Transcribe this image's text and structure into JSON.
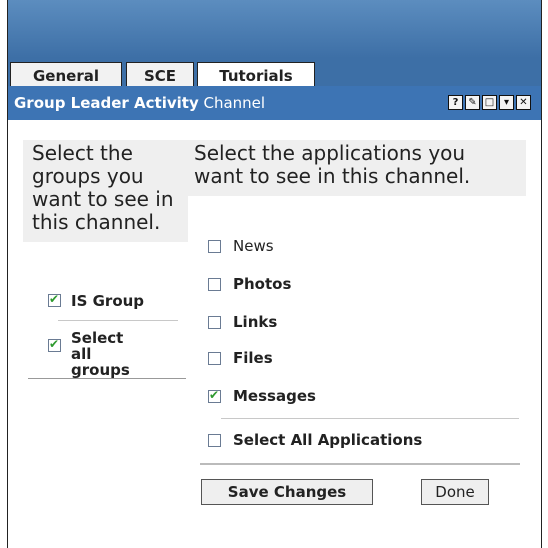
{
  "tabs": [
    "General",
    "SCE",
    "Tutorials"
  ],
  "channel": {
    "title_bold": "Group Leader Activity",
    "title_normal": " Channel"
  },
  "window_buttons": [
    "help-icon",
    "edit-icon",
    "maximize-icon",
    "minimize-icon",
    "close-icon"
  ],
  "groups": {
    "intro": "Select the groups you want to see in this channel.",
    "items": [
      {
        "label": "IS Group",
        "checked": true
      },
      {
        "label": "Select all groups",
        "checked": true
      }
    ]
  },
  "applications": {
    "intro": "Select the applications you want to see in this channel.",
    "items": [
      {
        "label": "News",
        "checked": false
      },
      {
        "label": "Photos",
        "checked": false
      },
      {
        "label": "Links",
        "checked": false
      },
      {
        "label": "Files",
        "checked": false
      },
      {
        "label": "Messages",
        "checked": true
      }
    ],
    "select_all": {
      "label": "Select All Applications",
      "checked": false
    }
  },
  "actions": {
    "save": "Save Changes",
    "done": "Done"
  },
  "colors": {
    "header": "#3d74b4",
    "panel": "#efefef",
    "check": "#2e9a2e"
  }
}
